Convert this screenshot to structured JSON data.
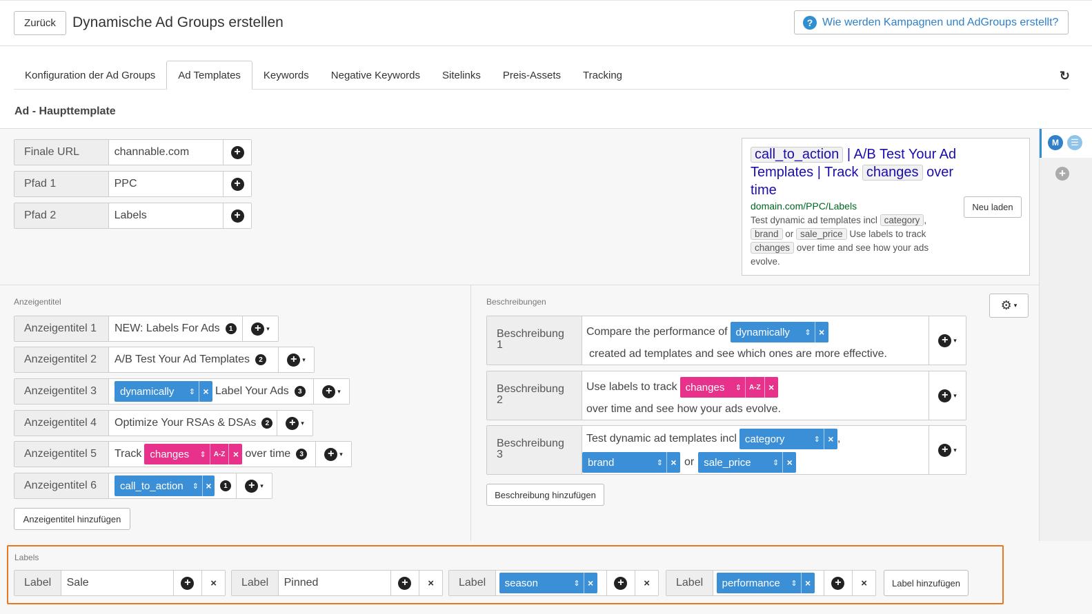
{
  "header": {
    "back_label": "Zurück",
    "title": "Dynamische Ad Groups erstellen",
    "help_icon": "?",
    "help_label": "Wie werden Kampagnen und AdGroups erstellt?"
  },
  "tabs": [
    {
      "label": "Konfiguration der Ad Groups"
    },
    {
      "label": "Ad Templates",
      "active": true
    },
    {
      "label": "Keywords"
    },
    {
      "label": "Negative Keywords"
    },
    {
      "label": "Sitelinks"
    },
    {
      "label": "Preis-Assets"
    },
    {
      "label": "Tracking"
    }
  ],
  "refresh_icon": "↻",
  "section_title": "Ad - Haupttemplate",
  "rail": {
    "m_badge": "M"
  },
  "url_fields": [
    {
      "label": "Finale URL",
      "value": "channable.com"
    },
    {
      "label": "Pfad 1",
      "value": "PPC"
    },
    {
      "label": "Pfad 2",
      "value": "Labels"
    }
  ],
  "preview": {
    "title_parts": [
      "call_to_action",
      " | A/B Test Your Ad Templates | Track ",
      "changes",
      " over time"
    ],
    "display_url": "domain.com/PPC/Labels",
    "desc_parts": [
      "Test dynamic ad templates incl ",
      "category",
      ", ",
      "brand",
      " or ",
      "sale_price",
      " Use labels to track ",
      "changes",
      " over time and see how your ads evolve."
    ],
    "reload_label": "Neu laden"
  },
  "headlines": {
    "heading": "Anzeigentitel",
    "rows": [
      {
        "label": "Anzeigentitel 1",
        "text": "NEW: Labels For Ads",
        "pin": "1"
      },
      {
        "label": "Anzeigentitel 2",
        "text": "A/B Test Your Ad Templates",
        "pin": "2"
      },
      {
        "label": "Anzeigentitel 3",
        "tag": "dynamically",
        "text": "Label Your Ads",
        "pin": "3"
      },
      {
        "label": "Anzeigentitel 4",
        "text": "Optimize Your RSAs & DSAs",
        "pin": "2"
      },
      {
        "label": "Anzeigentitel 5",
        "pre": "Track",
        "tag": "changes",
        "az": "A-Z",
        "text": "over time",
        "pin": "3"
      },
      {
        "label": "Anzeigentitel 6",
        "tag": "call_to_action",
        "pin": "1"
      }
    ],
    "add_label": "Anzeigentitel hinzufügen"
  },
  "descriptions": {
    "heading": "Beschreibungen",
    "rows": [
      {
        "label_a": "Beschreibung",
        "label_b": "1",
        "pre": "Compare the performance of",
        "tag": "dynamically",
        "post": "created ad templates and see which ones are more effective."
      },
      {
        "label_a": "Beschreibung",
        "label_b": "2",
        "pre": "Use labels to track",
        "tag": "changes",
        "az": "A-Z",
        "post": "over time and see how your ads evolve."
      },
      {
        "label_a": "Beschreibung",
        "label_b": "3",
        "pre": "Test dynamic ad templates incl",
        "tag": "category",
        "comma": ",",
        "tag2": "brand",
        "or": "or",
        "tag3": "sale_price"
      }
    ],
    "add_label": "Beschreibung hinzufügen",
    "settings_icon": "gear-icon"
  },
  "labels": {
    "heading": "Labels",
    "items": [
      {
        "label": "Label",
        "value": "Sale"
      },
      {
        "label": "Label",
        "value": "Pinned"
      },
      {
        "label": "Label",
        "tag": "season"
      },
      {
        "label": "Label",
        "tag": "performance"
      }
    ],
    "add_label": "Label hinzufügen"
  },
  "symbols": {
    "plus": "+",
    "close": "×",
    "sort": "⇕",
    "caret": "▾"
  },
  "colors": {
    "accent": "#2f80c8",
    "tag_blue": "#3a8fd6",
    "tag_pink": "#e8318a",
    "highlight": "#e87722",
    "link_title": "#1a0dab",
    "url_green": "#006621"
  }
}
